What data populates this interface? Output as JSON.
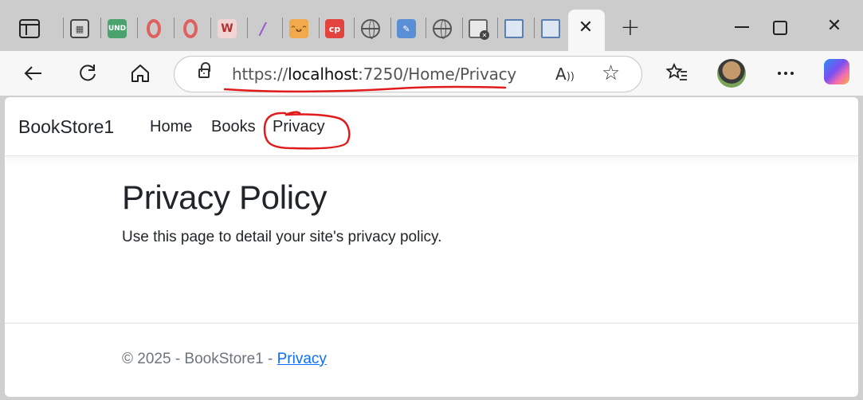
{
  "browser": {
    "tabs": [
      {
        "icon": "tab-actions-icon"
      },
      {
        "icon": "app-grid-icon"
      },
      {
        "icon": "und-icon",
        "label": "UND"
      },
      {
        "icon": "opera-ring-icon"
      },
      {
        "icon": "opera-ring-icon"
      },
      {
        "icon": "w-logo-icon",
        "label": "W"
      },
      {
        "icon": "slash-icon",
        "label": "/"
      },
      {
        "icon": "face-icon"
      },
      {
        "icon": "cp-icon",
        "label": "cp"
      },
      {
        "icon": "globe-icon"
      },
      {
        "icon": "document-icon"
      },
      {
        "icon": "globe-icon"
      },
      {
        "icon": "page-error-icon"
      },
      {
        "icon": "book-icon"
      },
      {
        "icon": "book-icon"
      }
    ],
    "active_tab_close": "✕",
    "new_tab": "+",
    "window_close": "✕",
    "address": {
      "scheme": "https://",
      "host": "localhost",
      "rest": ":7250/Home/Privacy"
    },
    "annotation_color": "#e01b1b"
  },
  "site": {
    "brand": "BookStore1",
    "nav": [
      "Home",
      "Books",
      "Privacy"
    ],
    "heading": "Privacy Policy",
    "body": "Use this page to detail your site's privacy policy.",
    "footer_text": "© 2025 - BookStore1 - ",
    "footer_link": "Privacy",
    "link_color": "#0d6efd"
  }
}
